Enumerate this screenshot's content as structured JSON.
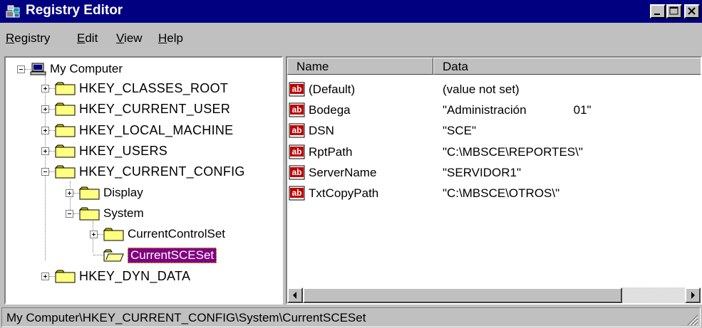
{
  "window": {
    "title": "Registry Editor"
  },
  "menu": [
    {
      "label": "Registry",
      "mnemonic": "R",
      "rest": "egistry"
    },
    {
      "label": "Edit",
      "mnemonic": "E",
      "rest": "dit"
    },
    {
      "label": "View",
      "mnemonic": "V",
      "rest": "iew"
    },
    {
      "label": "Help",
      "mnemonic": "H",
      "rest": "elp"
    }
  ],
  "tree": {
    "root": "My Computer",
    "items": [
      {
        "label": "HKEY_CLASSES_ROOT",
        "expander": "plus"
      },
      {
        "label": "HKEY_CURRENT_USER",
        "expander": "plus"
      },
      {
        "label": "HKEY_LOCAL_MACHINE",
        "expander": "plus"
      },
      {
        "label": "HKEY_USERS",
        "expander": "plus"
      },
      {
        "label": "HKEY_CURRENT_CONFIG",
        "expander": "minus"
      },
      {
        "label": "Display",
        "expander": "plus"
      },
      {
        "label": "System",
        "expander": "minus"
      },
      {
        "label": "CurrentControlSet",
        "expander": "plus"
      },
      {
        "label": "CurrentSCESet",
        "expander": "none",
        "selected": true
      },
      {
        "label": "HKEY_DYN_DATA",
        "expander": "plus"
      }
    ]
  },
  "list": {
    "columns": {
      "name": "Name",
      "data": "Data"
    },
    "rows": [
      {
        "name": "(Default)",
        "data": "(value not set)"
      },
      {
        "name": "Bodega",
        "data": "\"Administración              01\""
      },
      {
        "name": "DSN",
        "data": "\"SCE\""
      },
      {
        "name": "RptPath",
        "data": "\"C:\\MBSCE\\REPORTES\\\""
      },
      {
        "name": "ServerName",
        "data": "\"SERVIDOR1\""
      },
      {
        "name": "TxtCopyPath",
        "data": "\"C:\\MBSCE\\OTROS\\\""
      }
    ],
    "value_icon": "string-value-ab-icon"
  },
  "status": {
    "path": "My Computer\\HKEY_CURRENT_CONFIG\\System\\CurrentSCESet"
  },
  "colors": {
    "titlebar": "#000080",
    "selection": "#800080",
    "face": "#c0c0c0",
    "ab_red": "#c00000"
  }
}
